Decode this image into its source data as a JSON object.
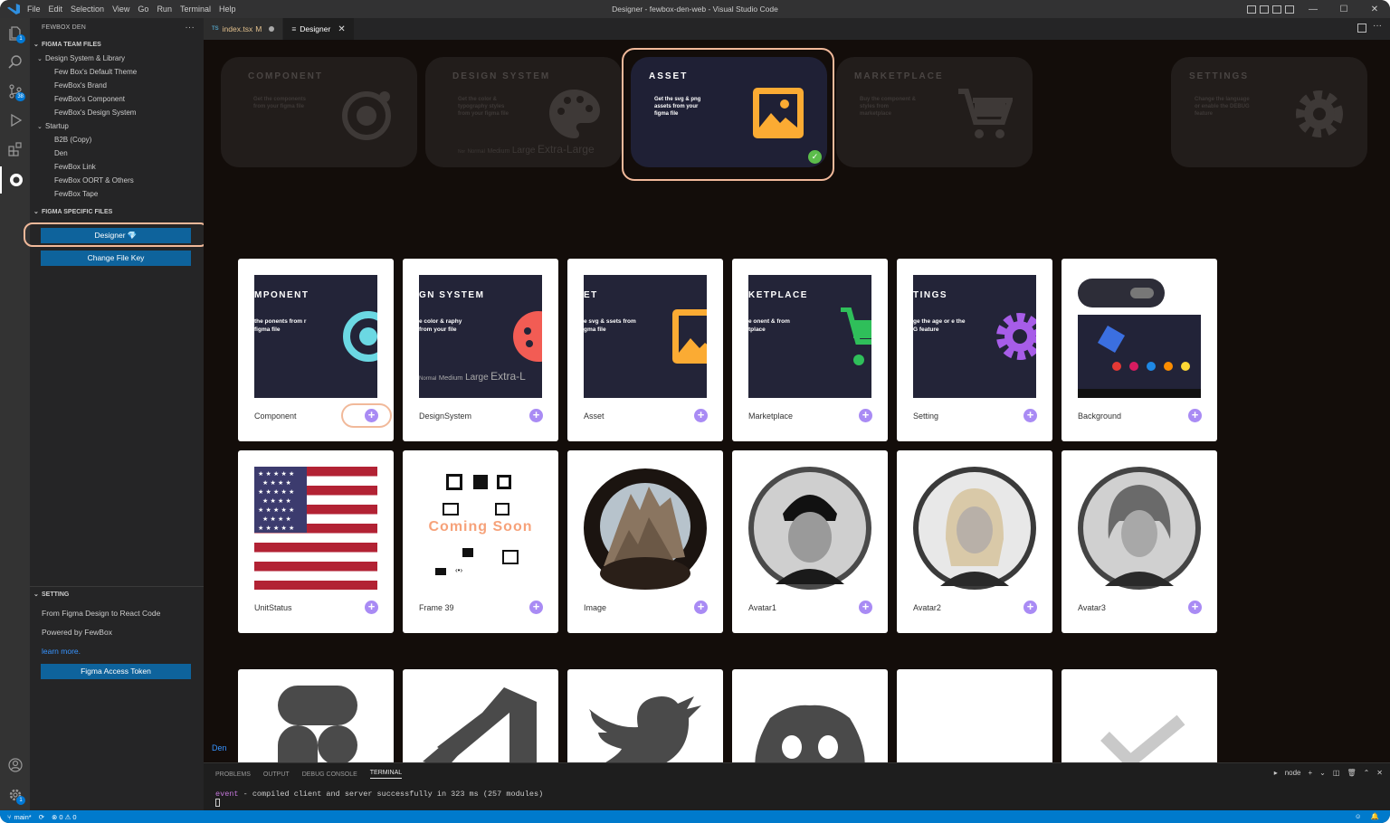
{
  "window": {
    "title": "Designer - fewbox-den-web - Visual Studio Code"
  },
  "menu": [
    "File",
    "Edit",
    "Selection",
    "View",
    "Go",
    "Run",
    "Terminal",
    "Help"
  ],
  "activity": {
    "explorer_badge": "1",
    "scm_badge": "38",
    "accounts_badge": "1"
  },
  "sidebar": {
    "title": "FEWBOX DEN",
    "team_section": "FIGMA TEAM FILES",
    "tree": [
      {
        "label": "Design System & Library",
        "level": 1,
        "chevron": "⌄"
      },
      {
        "label": "Few Box's Default Theme",
        "level": 2
      },
      {
        "label": "FewBox's Brand",
        "level": 2
      },
      {
        "label": "FewBox's Component",
        "level": 2
      },
      {
        "label": "FewBox's Design System",
        "level": 2
      },
      {
        "label": "Startup",
        "level": 1,
        "chevron": "⌄"
      },
      {
        "label": "B2B (Copy)",
        "level": 2
      },
      {
        "label": "Den",
        "level": 2
      },
      {
        "label": "FewBox Link",
        "level": 2
      },
      {
        "label": "FewBox OORT & Others",
        "level": 2
      },
      {
        "label": "FewBox Tape",
        "level": 2
      }
    ],
    "specific_section": "FIGMA SPECIFIC FILES",
    "designer_button": "Designer 💎",
    "change_key_button": "Change File Key",
    "setting_section": "SETTING",
    "setting_line1": "From Figma Design to React Code",
    "setting_line2": "Powered by FewBox",
    "learn_more": "learn more.",
    "token_button": "Figma Access Token"
  },
  "tabs": [
    {
      "ts": "TS",
      "label": "index.tsx",
      "mod": "M"
    },
    {
      "label": "Designer"
    }
  ],
  "hero": [
    {
      "title": "COMPONENT",
      "desc": "Get the components from your figma file"
    },
    {
      "title": "DESIGN SYSTEM",
      "desc": "Get the color & typography styles from your figma file",
      "sizes": [
        "Nor",
        "Normal",
        "Medium",
        "Large",
        "Extra-Large"
      ]
    },
    {
      "title": "ASSET",
      "desc": "Get the svg & png assets from your figma file"
    },
    {
      "title": "MARKETPLACE",
      "desc": "Buy the component & styles from marketplace"
    },
    {
      "title": "SETTINGS",
      "desc": "Change the language or enable the DEBUG feature"
    }
  ],
  "tiles_row1": [
    {
      "name": "Component",
      "thumb_title": "MPONENT",
      "thumb_desc": "the ponents from r figma file"
    },
    {
      "name": "DesignSystem",
      "thumb_title": "GN SYSTEM",
      "thumb_desc": "e color & raphy from your file",
      "sizes": [
        "Normal",
        "Medium",
        "Large",
        "Extra-L"
      ]
    },
    {
      "name": "Asset",
      "thumb_title": "ET",
      "thumb_desc": "e svg & ssets from gma file"
    },
    {
      "name": "Marketplace",
      "thumb_title": "KETPLACE",
      "thumb_desc": "e onent & from tplace"
    },
    {
      "name": "Setting",
      "thumb_title": "TINGS",
      "thumb_desc": "ge the age or e the G feature"
    },
    {
      "name": "Background"
    }
  ],
  "tiles_row2": [
    {
      "name": "UnitStatus"
    },
    {
      "name": "Frame 39",
      "coming": "Coming Soon"
    },
    {
      "name": "Image"
    },
    {
      "name": "Avatar1"
    },
    {
      "name": "Avatar2"
    },
    {
      "name": "Avatar3"
    }
  ],
  "plus_label": "+",
  "editor_footer": "Den",
  "panel": {
    "tabs": [
      "PROBLEMS",
      "OUTPUT",
      "DEBUG CONSOLE",
      "TERMINAL"
    ],
    "shell": "node",
    "terminal_event": "event",
    "terminal_text": " - compiled client and server successfully in 323 ms (257 modules)"
  },
  "status": {
    "branch": "main*",
    "errors": "⊗ 0 ⚠ 0"
  }
}
